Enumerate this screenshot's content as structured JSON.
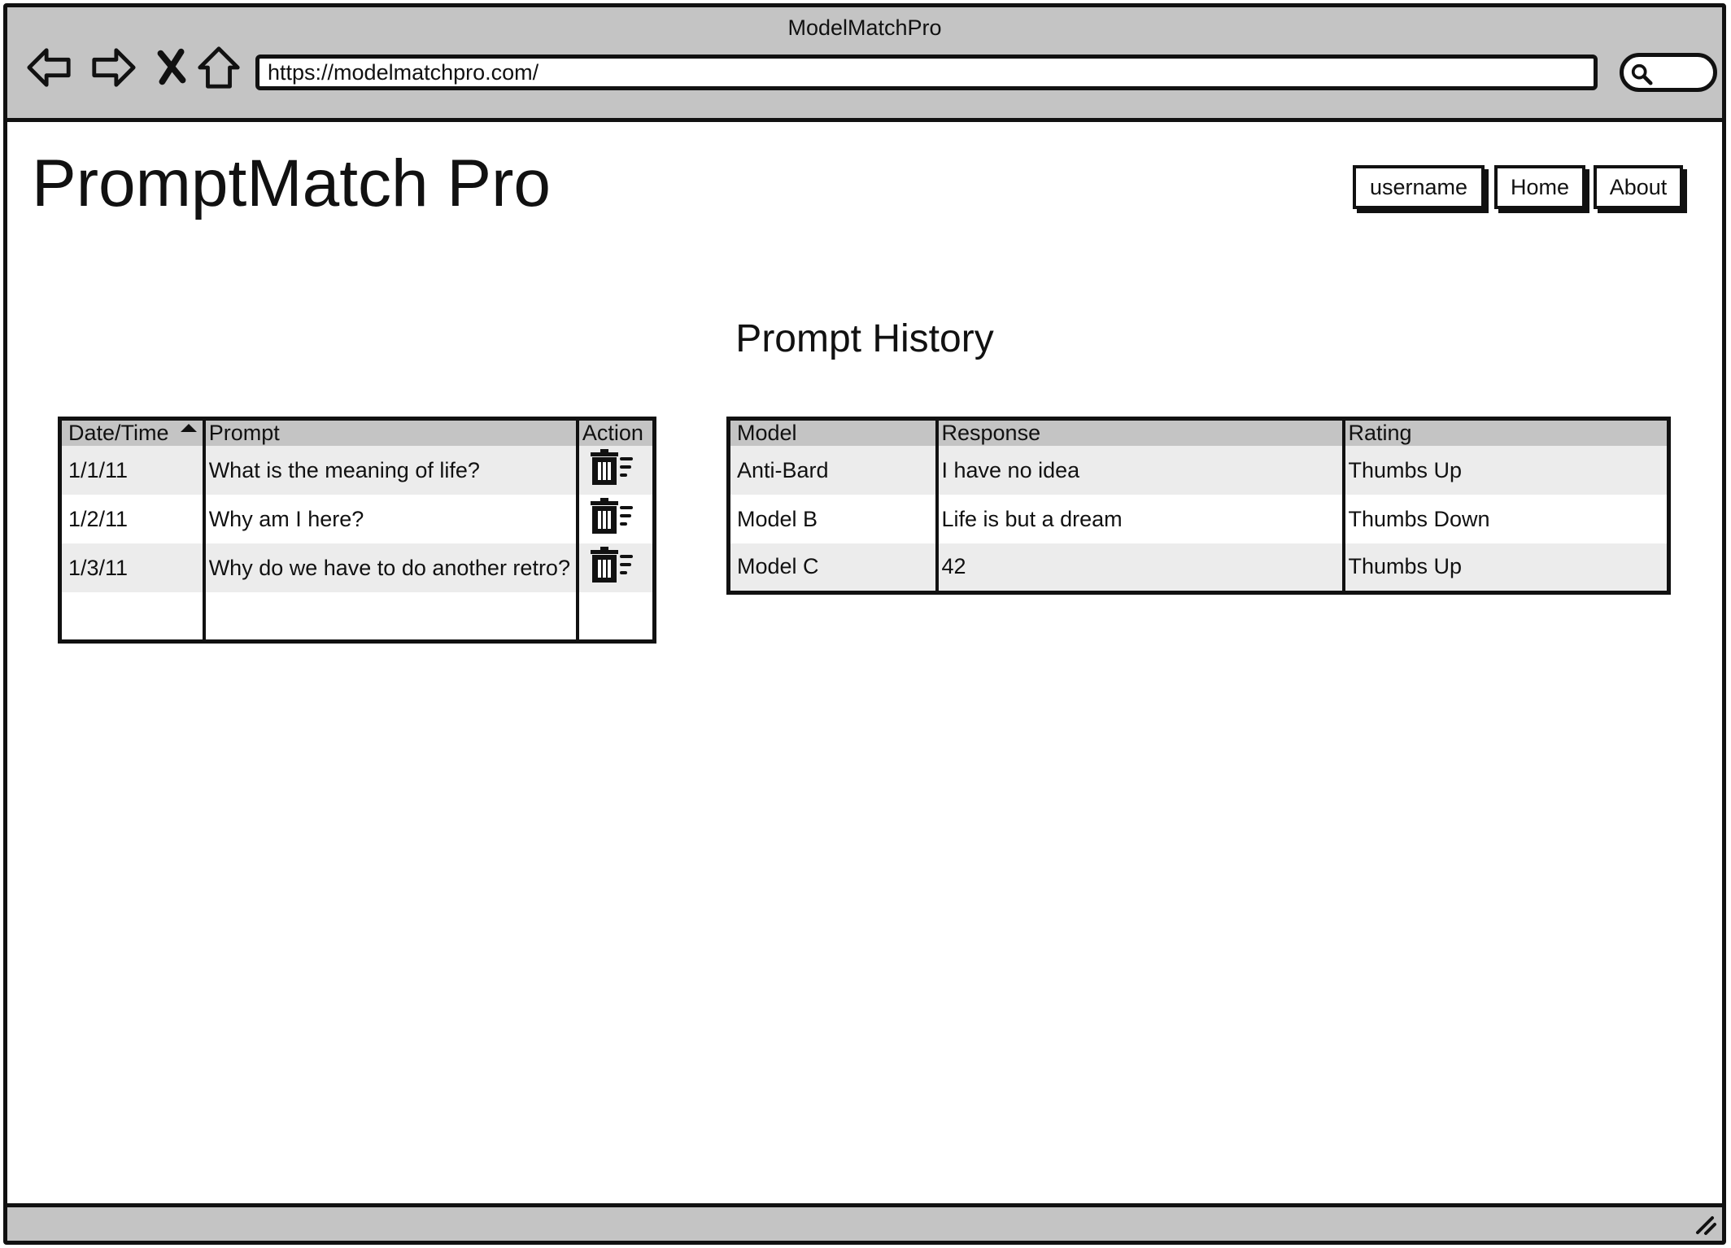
{
  "browser": {
    "window_title": "ModelMatchPro",
    "url": "https://modelmatchpro.com/",
    "nav_icons": [
      "back-arrow-icon",
      "forward-arrow-icon",
      "stop-x-icon",
      "home-icon"
    ],
    "search_icon": "magnifier-icon"
  },
  "header": {
    "app_title": "PromptMatch Pro",
    "nav": {
      "username": "username",
      "home": "Home",
      "about": "About"
    }
  },
  "page": {
    "title": "Prompt History"
  },
  "history_table": {
    "columns": [
      "Date/Time",
      "Prompt",
      "Action"
    ],
    "sort": {
      "column": "Date/Time",
      "direction": "ascending"
    },
    "action_icon": "delete-trash-icon",
    "rows": [
      {
        "date": "1/1/11",
        "prompt": "What is the meaning of life?"
      },
      {
        "date": "1/2/11",
        "prompt": "Why am I here?"
      },
      {
        "date": "1/3/11",
        "prompt": "Why do we have to do another retro?"
      }
    ]
  },
  "response_table": {
    "columns": [
      "Model",
      "Response",
      "Rating"
    ],
    "rows": [
      {
        "model": "Anti-Bard",
        "response": "I have no idea",
        "rating": "Thumbs Up"
      },
      {
        "model": "Model B",
        "response": "Life is but a dream",
        "rating": "Thumbs Down"
      },
      {
        "model": "Model C",
        "response": "42",
        "rating": "Thumbs Up"
      }
    ]
  },
  "colors": {
    "chrome_gray": "#c4c4c4",
    "row_stripe": "#ececec",
    "ink": "#111111"
  }
}
